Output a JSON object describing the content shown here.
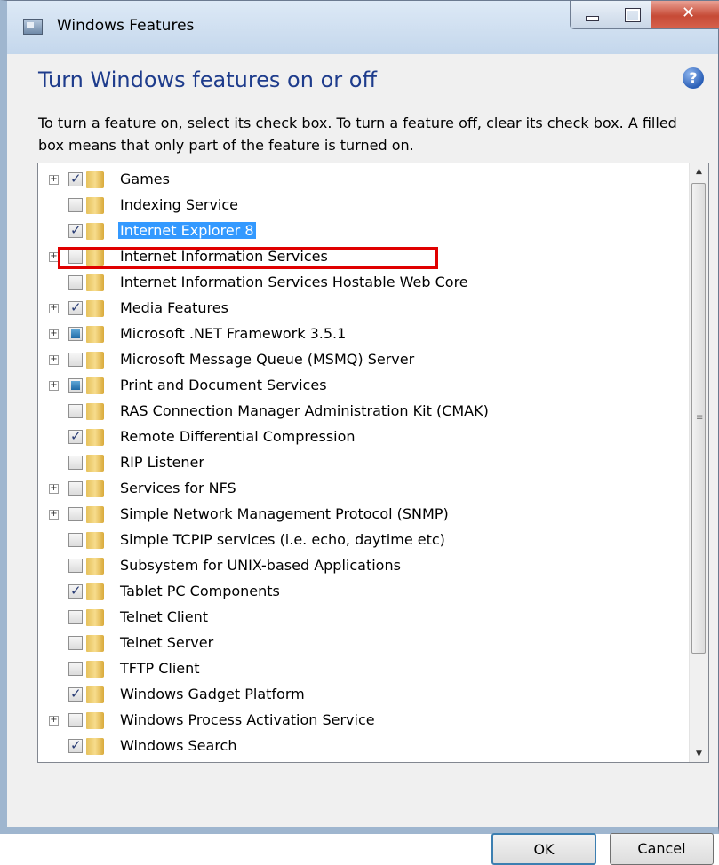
{
  "window": {
    "title": "Windows Features"
  },
  "heading": "Turn Windows features on or off",
  "description": "To turn a feature on, select its check box. To turn a feature off, clear its check box. A filled box means that only part of the feature is turned on.",
  "features": [
    {
      "label": "Games",
      "state": "checked",
      "expandable": true
    },
    {
      "label": "Indexing Service",
      "state": "unchecked",
      "expandable": false
    },
    {
      "label": "Internet Explorer 8",
      "state": "checked",
      "expandable": false,
      "selected": true
    },
    {
      "label": "Internet Information Services",
      "state": "unchecked",
      "expandable": true
    },
    {
      "label": "Internet Information Services Hostable Web Core",
      "state": "unchecked",
      "expandable": false
    },
    {
      "label": "Media Features",
      "state": "checked",
      "expandable": true
    },
    {
      "label": "Microsoft .NET Framework 3.5.1",
      "state": "partial",
      "expandable": true
    },
    {
      "label": "Microsoft Message Queue (MSMQ) Server",
      "state": "unchecked",
      "expandable": true
    },
    {
      "label": "Print and Document Services",
      "state": "partial",
      "expandable": true
    },
    {
      "label": "RAS Connection Manager Administration Kit (CMAK)",
      "state": "unchecked",
      "expandable": false
    },
    {
      "label": "Remote Differential Compression",
      "state": "checked",
      "expandable": false
    },
    {
      "label": "RIP Listener",
      "state": "unchecked",
      "expandable": false
    },
    {
      "label": "Services for NFS",
      "state": "unchecked",
      "expandable": true
    },
    {
      "label": "Simple Network Management Protocol (SNMP)",
      "state": "unchecked",
      "expandable": true
    },
    {
      "label": "Simple TCPIP services (i.e. echo, daytime etc)",
      "state": "unchecked",
      "expandable": false
    },
    {
      "label": "Subsystem for UNIX-based Applications",
      "state": "unchecked",
      "expandable": false
    },
    {
      "label": "Tablet PC Components",
      "state": "checked",
      "expandable": false
    },
    {
      "label": "Telnet Client",
      "state": "unchecked",
      "expandable": false
    },
    {
      "label": "Telnet Server",
      "state": "unchecked",
      "expandable": false
    },
    {
      "label": "TFTP Client",
      "state": "unchecked",
      "expandable": false
    },
    {
      "label": "Windows Gadget Platform",
      "state": "checked",
      "expandable": false
    },
    {
      "label": "Windows Process Activation Service",
      "state": "unchecked",
      "expandable": true
    },
    {
      "label": "Windows Search",
      "state": "checked",
      "expandable": false
    }
  ],
  "buttons": {
    "ok": "OK",
    "cancel": "Cancel"
  },
  "colors": {
    "heading": "#1e3c8c",
    "selection": "#3399ff",
    "annotation": "#e00000"
  }
}
